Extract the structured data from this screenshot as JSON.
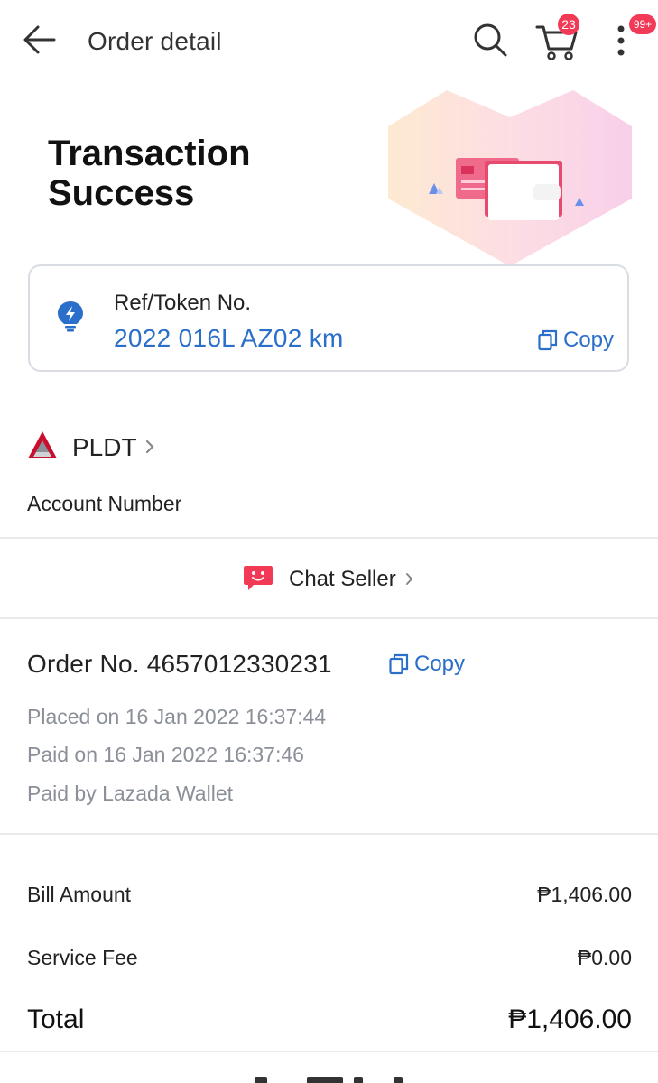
{
  "header": {
    "title": "Order detail",
    "cart_count": "23",
    "notification_count": "99+",
    "icons": [
      "back-arrow-icon",
      "search-icon",
      "cart-icon",
      "more-vertical-icon"
    ]
  },
  "hero": {
    "title_line1": "Transaction",
    "title_line2": "Success"
  },
  "token": {
    "label": "Ref/Token No.",
    "value": "2022 016L AZ02 km",
    "copy_label": "Copy"
  },
  "seller": {
    "name": "PLDT",
    "account_label": "Account Number",
    "chat_label": "Chat Seller"
  },
  "order": {
    "number_text": "Order No. 4657012330231",
    "copy_label": "Copy",
    "placed": "Placed on 16 Jan 2022 16:37:44",
    "paid": "Paid on 16 Jan 2022 16:37:46",
    "paid_by": "Paid by Lazada Wallet"
  },
  "amounts": {
    "bill_label": "Bill Amount",
    "bill_value": "₱1,406.00",
    "fee_label": "Service Fee",
    "fee_value": "₱0.00",
    "total_label": "Total",
    "total_value": "₱1,406.00"
  },
  "colors": {
    "accent_blue": "#2a6fc9",
    "badge_red": "#f23a57",
    "muted_text": "#8a8f98"
  }
}
